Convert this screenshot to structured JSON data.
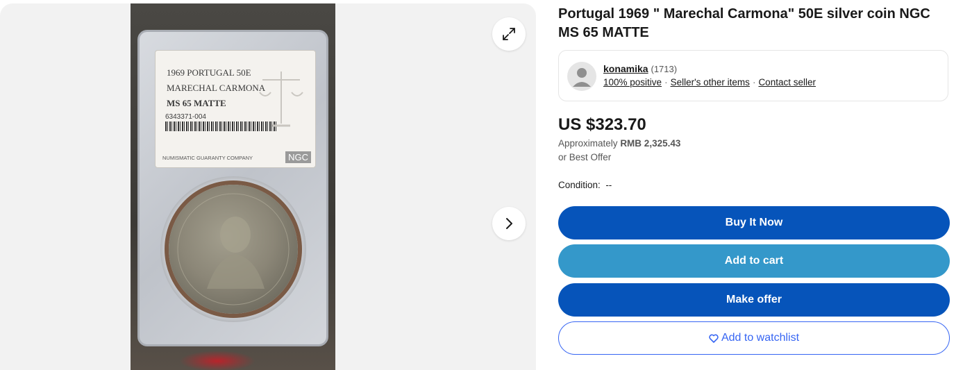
{
  "gallery": {
    "slab_label": {
      "line1": "1969 PORTUGAL 50E",
      "line2": "MARECHAL CARMONA",
      "grade": "MS 65 MATTE",
      "cert": "6343371-004",
      "company": "NUMISMATIC GUARANTY COMPANY",
      "logo": "NGC"
    },
    "icons": {
      "expand": "expand-icon",
      "next": "chevron-right-icon"
    }
  },
  "listing": {
    "title": "Portugal 1969 \" Marechal Carmona\" 50E silver coin NGC MS 65 MATTE",
    "seller": {
      "name": "konamika",
      "feedback_count": "(1713)",
      "positive": "100% positive",
      "other_items": "Seller's other items",
      "contact": "Contact seller"
    },
    "price": "US $323.70",
    "approx_prefix": "Approximately",
    "approx_value": "RMB 2,325.43",
    "best_offer": "or Best Offer",
    "condition_label": "Condition:",
    "condition_value": "--",
    "buttons": {
      "buy_now": "Buy It Now",
      "add_to_cart": "Add to cart",
      "make_offer": "Make offer",
      "watchlist": "Add to watchlist"
    }
  },
  "colors": {
    "primary_blue": "#0654ba",
    "cart_blue": "#3498ca",
    "link_blue": "#3665f3"
  }
}
